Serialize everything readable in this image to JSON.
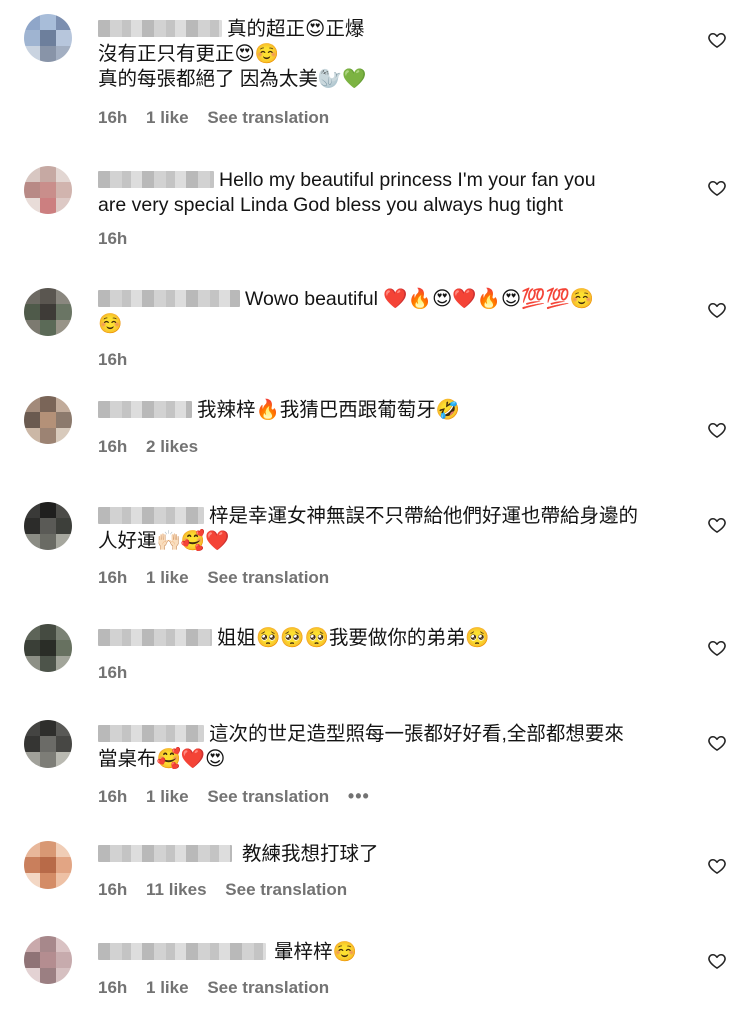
{
  "comments": [
    {
      "lines": [
        "真的超正😍正爆",
        "沒有正只有更正😍☺️",
        "真的每張都絕了 因為太美🦭💚"
      ],
      "time": "16h",
      "likes": "1 like",
      "translate": "See translation",
      "more": ""
    },
    {
      "lines": [
        "Hello my beautiful princess I'm your fan you",
        "are very special Linda God bless you always hug tight"
      ],
      "time": "16h",
      "likes": "",
      "translate": "",
      "more": ""
    },
    {
      "lines": [
        "Wowo beautiful ❤️🔥😍❤️🔥😍💯💯☺️",
        "☺️"
      ],
      "time": "16h",
      "likes": "",
      "translate": "",
      "more": ""
    },
    {
      "lines": [
        "我辣梓🔥我猜巴西跟葡萄牙🤣"
      ],
      "time": "16h",
      "likes": "2 likes",
      "translate": "",
      "more": ""
    },
    {
      "lines": [
        "梓是幸運女神無誤不只帶給他們好運也帶給身邊的",
        "人好運🙌🏻🥰❤️"
      ],
      "time": "16h",
      "likes": "1 like",
      "translate": "See translation",
      "more": ""
    },
    {
      "lines": [
        "姐姐🥺🥺🥺我要做你的弟弟🥺"
      ],
      "time": "16h",
      "likes": "",
      "translate": "",
      "more": ""
    },
    {
      "lines": [
        "這次的世足造型照每一張都好好看,全部都想要來",
        "當桌布🥰❤️😍"
      ],
      "time": "16h",
      "likes": "1 like",
      "translate": "See translation",
      "more": "•••"
    },
    {
      "lines": [
        "教練我想打球了"
      ],
      "time": "16h",
      "likes": "11 likes",
      "translate": "See translation",
      "more": ""
    },
    {
      "lines": [
        "暈梓梓☺️"
      ],
      "time": "16h",
      "likes": "1 like",
      "translate": "See translation",
      "more": ""
    }
  ],
  "icons": {
    "like": "heart-icon",
    "more": "more-options-icon"
  },
  "colors": {
    "meta": "#737373",
    "text": "#141414"
  }
}
